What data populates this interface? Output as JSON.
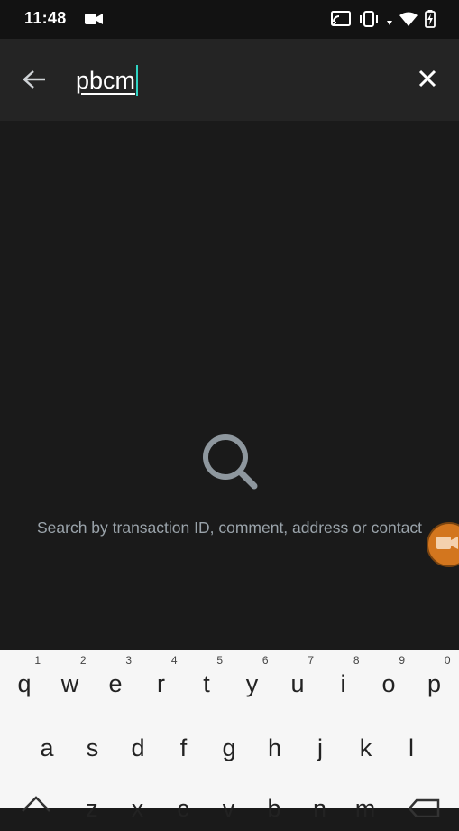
{
  "status_bar": {
    "time": "11:48",
    "icons": [
      "video-camera-icon",
      "cast-icon",
      "vibrate-icon",
      "wifi-icon",
      "battery-charging-icon"
    ]
  },
  "search": {
    "query": "pbcm",
    "back_icon": "arrow-left-icon",
    "clear_icon": "close-icon",
    "caret_color": "#2fd4c4"
  },
  "empty_state": {
    "icon": "magnifier-icon",
    "message": "Search by transaction ID, comment, address or contact"
  },
  "floating_bubble": {
    "icon": "video-camera-icon",
    "color": "#d3761e"
  },
  "keyboard": {
    "row1": [
      {
        "key": "q",
        "hint": "1"
      },
      {
        "key": "w",
        "hint": "2"
      },
      {
        "key": "e",
        "hint": "3"
      },
      {
        "key": "r",
        "hint": "4"
      },
      {
        "key": "t",
        "hint": "5"
      },
      {
        "key": "y",
        "hint": "6"
      },
      {
        "key": "u",
        "hint": "7"
      },
      {
        "key": "i",
        "hint": "8"
      },
      {
        "key": "o",
        "hint": "9"
      },
      {
        "key": "p",
        "hint": "0"
      }
    ],
    "row2": [
      "a",
      "s",
      "d",
      "f",
      "g",
      "h",
      "j",
      "k",
      "l"
    ],
    "row3": [
      "z",
      "x",
      "c",
      "v",
      "b",
      "n",
      "m"
    ]
  }
}
